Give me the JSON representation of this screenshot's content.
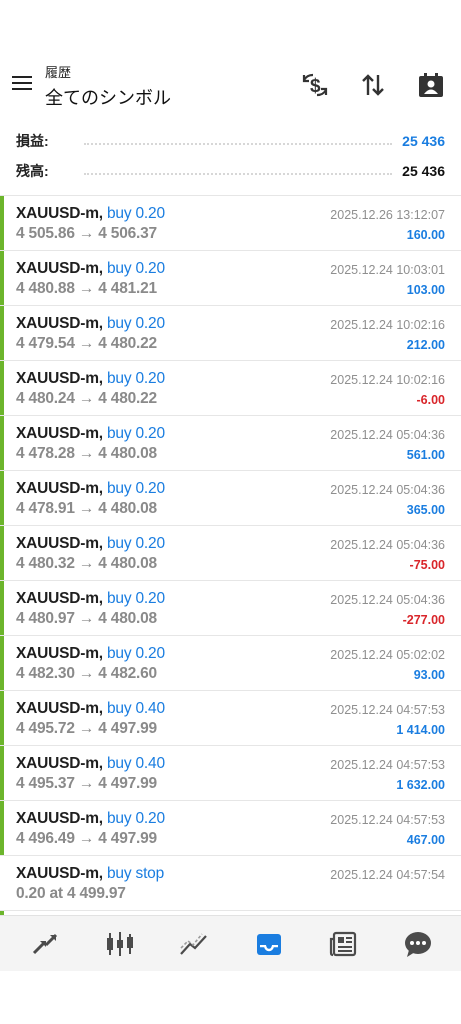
{
  "header": {
    "subtitle": "履歴",
    "title": "全てのシンボル",
    "icons": [
      "menu-icon",
      "currency-exchange-icon",
      "sort-icon",
      "calendar-contact-icon"
    ]
  },
  "summary": {
    "profit_label": "損益:",
    "profit_value": "25 436",
    "balance_label": "残高:",
    "balance_value": "25 436"
  },
  "colors": {
    "accent": "#1a7de0",
    "positive": "#1a7de0",
    "negative": "#d9252a",
    "buy_bar": "#6cb52c",
    "muted": "#8a8a8a"
  },
  "trades": [
    {
      "symbol": "XAUUSD-m,",
      "side": "buy 0.20",
      "prices": "4 505.86 → 4 506.37",
      "time": "2025.12.26 13:12:07",
      "profit": "160.00",
      "profit_type": "positive",
      "bar": true
    },
    {
      "symbol": "XAUUSD-m,",
      "side": "buy 0.20",
      "prices": "4 480.88 → 4 481.21",
      "time": "2025.12.24 10:03:01",
      "profit": "103.00",
      "profit_type": "positive",
      "bar": true
    },
    {
      "symbol": "XAUUSD-m,",
      "side": "buy 0.20",
      "prices": "4 479.54 → 4 480.22",
      "time": "2025.12.24 10:02:16",
      "profit": "212.00",
      "profit_type": "positive",
      "bar": true
    },
    {
      "symbol": "XAUUSD-m,",
      "side": "buy 0.20",
      "prices": "4 480.24 → 4 480.22",
      "time": "2025.12.24 10:02:16",
      "profit": "-6.00",
      "profit_type": "negative",
      "bar": true
    },
    {
      "symbol": "XAUUSD-m,",
      "side": "buy 0.20",
      "prices": "4 478.28 → 4 480.08",
      "time": "2025.12.24 05:04:36",
      "profit": "561.00",
      "profit_type": "positive",
      "bar": true
    },
    {
      "symbol": "XAUUSD-m,",
      "side": "buy 0.20",
      "prices": "4 478.91 → 4 480.08",
      "time": "2025.12.24 05:04:36",
      "profit": "365.00",
      "profit_type": "positive",
      "bar": true
    },
    {
      "symbol": "XAUUSD-m,",
      "side": "buy 0.20",
      "prices": "4 480.32 → 4 480.08",
      "time": "2025.12.24 05:04:36",
      "profit": "-75.00",
      "profit_type": "negative",
      "bar": true
    },
    {
      "symbol": "XAUUSD-m,",
      "side": "buy 0.20",
      "prices": "4 480.97 → 4 480.08",
      "time": "2025.12.24 05:04:36",
      "profit": "-277.00",
      "profit_type": "negative",
      "bar": true
    },
    {
      "symbol": "XAUUSD-m,",
      "side": "buy 0.20",
      "prices": "4 482.30 → 4 482.60",
      "time": "2025.12.24 05:02:02",
      "profit": "93.00",
      "profit_type": "positive",
      "bar": true
    },
    {
      "symbol": "XAUUSD-m,",
      "side": "buy 0.40",
      "prices": "4 495.72 → 4 497.99",
      "time": "2025.12.24 04:57:53",
      "profit": "1 414.00",
      "profit_type": "positive",
      "bar": true
    },
    {
      "symbol": "XAUUSD-m,",
      "side": "buy 0.40",
      "prices": "4 495.37 → 4 497.99",
      "time": "2025.12.24 04:57:53",
      "profit": "1 632.00",
      "profit_type": "positive",
      "bar": true
    },
    {
      "symbol": "XAUUSD-m,",
      "side": "buy 0.20",
      "prices": "4 496.49 → 4 497.99",
      "time": "2025.12.24 04:57:53",
      "profit": "467.00",
      "profit_type": "positive",
      "bar": true
    },
    {
      "symbol": "XAUUSD-m,",
      "side": "buy stop",
      "prices": "0.20 at 4 499.97",
      "time": "2025.12.24 04:57:54",
      "profit": "",
      "profit_type": "none",
      "bar": false
    }
  ],
  "bottom_nav": [
    {
      "icon": "quotes-icon",
      "active": false
    },
    {
      "icon": "candlestick-chart-icon",
      "active": false
    },
    {
      "icon": "trade-icon",
      "active": false
    },
    {
      "icon": "history-inbox-icon",
      "active": true
    },
    {
      "icon": "news-icon",
      "active": false
    },
    {
      "icon": "chat-icon",
      "active": false
    }
  ]
}
